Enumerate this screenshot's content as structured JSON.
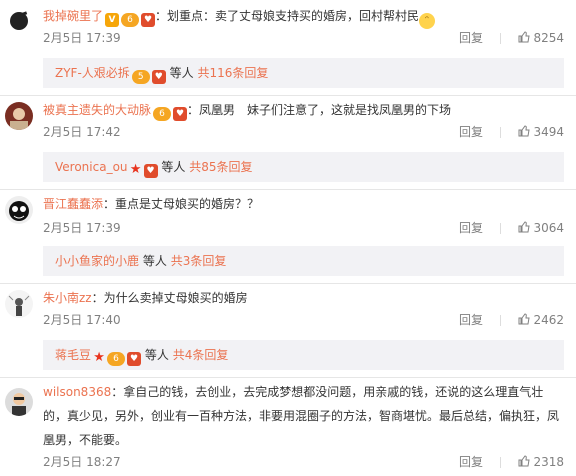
{
  "comments": [
    {
      "username": "我掉碗里了",
      "text": "：划重点：卖了丈母娘支持买的婚房，回村帮村民",
      "time": "2月5日 17:39",
      "reply_label": "回复",
      "likes": "8254",
      "sub": {
        "user": "ZYF-人艰必拆",
        "etc": "等人",
        "count": "共116条回复"
      }
    },
    {
      "username": "被真主遗失的大动脉",
      "text": "：凤凰男　妹子们注意了，这就是找凤凰男的下场",
      "time": "2月5日 17:42",
      "reply_label": "回复",
      "likes": "3494",
      "sub": {
        "user": "Veronica_ou",
        "etc": "等人",
        "count": "共85条回复"
      }
    },
    {
      "username": "晋江蠢蠢添",
      "text": "：重点是丈母娘买的婚房？？",
      "time": "2月5日 17:39",
      "reply_label": "回复",
      "likes": "3064",
      "sub": {
        "user": "小小鱼家的小鹿",
        "etc": "等人",
        "count": "共3条回复"
      }
    },
    {
      "username": "朱小南zz",
      "text": "：为什么卖掉丈母娘买的婚房",
      "time": "2月5日 17:40",
      "reply_label": "回复",
      "likes": "2462",
      "sub": {
        "user": "蒋毛豆",
        "etc": "等人",
        "count": "共4条回复"
      }
    },
    {
      "username": "wilson8368",
      "text": "：拿自己的钱，去创业，去完成梦想都没问题，用亲戚的钱，还说的这么理直气壮的，真少见，另外，创业有一百种方法，非要用混圈子的方法，智商堪忧。最后总结，偏执狂，凤凰男，不能要。",
      "time": "2月5日 18:27",
      "reply_label": "回复",
      "likes": "2318"
    }
  ],
  "icons": {
    "like": "thumbs-up-icon",
    "emoji": "cat-face-icon"
  },
  "colors": {
    "link": "#eb7350",
    "meta": "#808080",
    "subreply_bg": "#f2f2f5"
  }
}
